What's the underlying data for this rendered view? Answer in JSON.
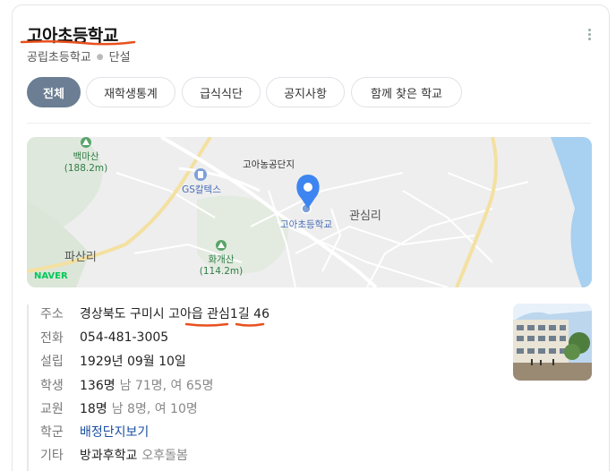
{
  "header": {
    "title": "고아초등학교",
    "school_type": "공립초등학교",
    "gender": "단설"
  },
  "tabs": [
    {
      "label": "전체",
      "active": true
    },
    {
      "label": "재학생통계",
      "active": false
    },
    {
      "label": "급식식단",
      "active": false
    },
    {
      "label": "공지사항",
      "active": false
    },
    {
      "label": "함께 찾은 학교",
      "active": false
    }
  ],
  "map": {
    "labels": {
      "baekma_mt": "백마산",
      "baekma_height": "(188.2m)",
      "gs": "GS칼텍스",
      "industrial": "고아농공단지",
      "school": "고아초등학교",
      "gwansim": "관심리",
      "pasan": "파산리",
      "hwagae_mt": "화개산",
      "hwagae_height": "(114.2m)",
      "naver": "NAVER"
    },
    "colors": {
      "pin": "#3d85f0",
      "water": "#a8d0f0",
      "naver": "#03c75a"
    }
  },
  "info": {
    "address": {
      "key": "주소",
      "p1": "경상북도 구미시 ",
      "p2": "고아읍",
      "p3": " ",
      "p4": "관심",
      "p5": "1길 46"
    },
    "phone": {
      "key": "전화",
      "value": "054-481-3005"
    },
    "founded": {
      "key": "설립",
      "value": "1929년 09월 10일"
    },
    "students": {
      "key": "학생",
      "value": "136명",
      "detail": "남 71명, 여 65명"
    },
    "teachers": {
      "key": "교원",
      "value": "18명",
      "detail": "남 8명, 여 10명"
    },
    "district": {
      "key": "학군",
      "value": "배정단지보기"
    },
    "etc": {
      "key": "기타",
      "value": "방과후학교",
      "detail": "오후돌봄"
    }
  },
  "annotation_color": "#e8501e"
}
